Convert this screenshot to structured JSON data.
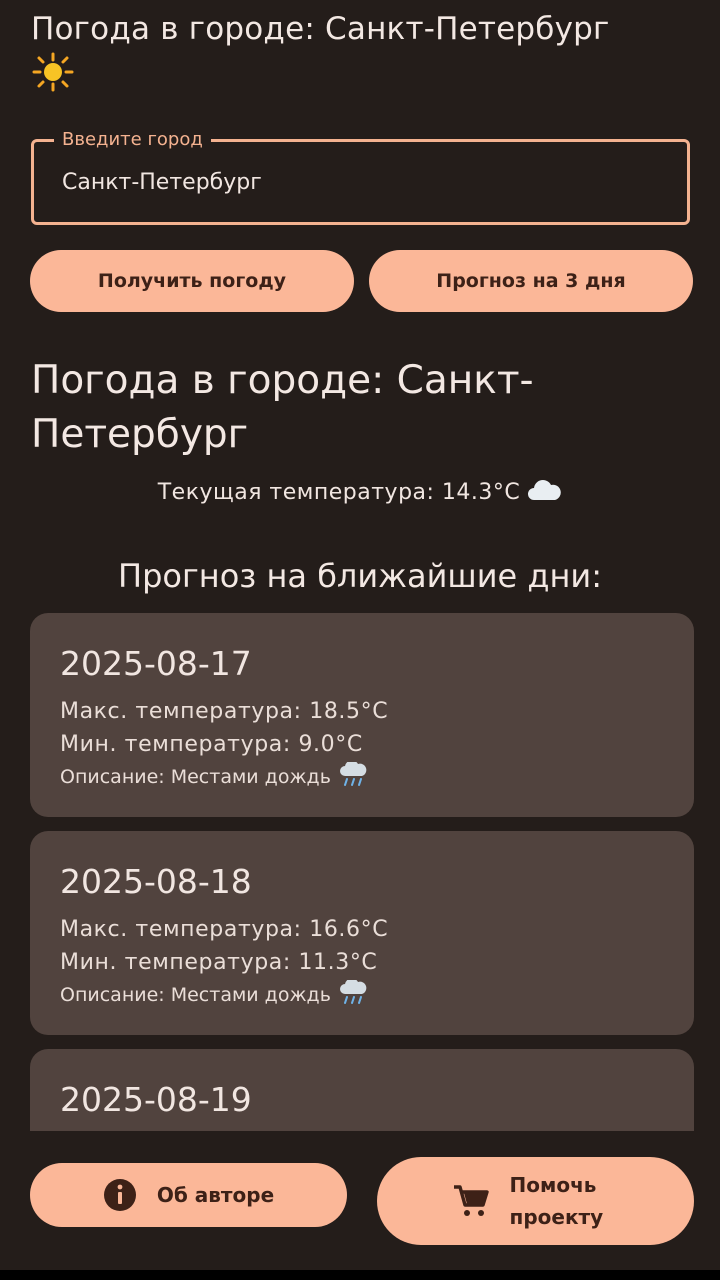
{
  "header": {
    "title": "Погода в городе: Санкт-Петербург",
    "weather_icon": "sun-icon"
  },
  "search": {
    "label": "Введите город",
    "value": "Санкт-Петербург"
  },
  "buttons": {
    "get_weather": "Получить погоду",
    "forecast_3_days": "Прогноз на 3 дня",
    "about_author": "Об авторе",
    "help_project": "Помочь проекту"
  },
  "result": {
    "title": "Погода в городе: Санкт-Петербург",
    "current_temp_label": "Текущая температура: 14.3°C",
    "current_icon": "cloud-icon"
  },
  "forecast": {
    "heading": "Прогноз на ближайшие дни:",
    "days": [
      {
        "date": "2025-08-17",
        "max": "Макс. температура: 18.5°C",
        "min": "Мин. температура: 9.0°C",
        "desc": "Описание: Местами дождь",
        "icon": "rain-cloud-icon"
      },
      {
        "date": "2025-08-18",
        "max": "Макс. температура: 16.6°C",
        "min": "Мин. температура: 11.3°C",
        "desc": "Описание: Местами дождь",
        "icon": "rain-cloud-icon"
      },
      {
        "date": "2025-08-19"
      }
    ]
  },
  "colors": {
    "background": "#241d1a",
    "accent": "#fbb798",
    "field_border": "#f4b290",
    "card": "#51433e",
    "button_text": "#3d2117"
  }
}
